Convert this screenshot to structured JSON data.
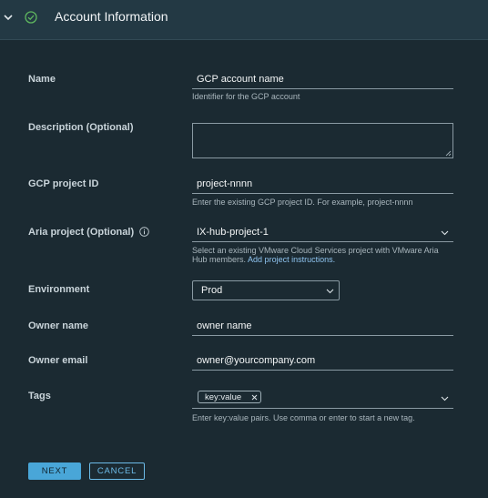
{
  "header": {
    "title": "Account Information",
    "status_color": "#5fb85f"
  },
  "form": {
    "name": {
      "label": "Name",
      "value": "GCP account name",
      "help": "Identifier for the GCP account"
    },
    "description": {
      "label": "Description (Optional)",
      "value": ""
    },
    "gcp_project_id": {
      "label": "GCP project ID",
      "value": "project-nnnn",
      "help": "Enter the existing GCP project ID. For example, project-nnnn"
    },
    "aria_project": {
      "label": "Aria project (Optional)",
      "value": "IX-hub-project-1",
      "help_line1": "Select an existing VMware Cloud Services project with VMware Aria",
      "help_line2": "Hub members.",
      "help_link": "Add project instructions."
    },
    "environment": {
      "label": "Environment",
      "value": "Prod"
    },
    "owner_name": {
      "label": "Owner name",
      "value": "owner name"
    },
    "owner_email": {
      "label": "Owner email",
      "value": "owner@yourcompany.com"
    },
    "tags": {
      "label": "Tags",
      "tag": "key:value",
      "help": "Enter key:value pairs. Use comma or enter to start a new tag."
    }
  },
  "buttons": {
    "next": "NEXT",
    "cancel": "CANCEL"
  },
  "colors": {
    "background": "#1b2a32",
    "header": "#233944",
    "accent": "#49a6d8",
    "link": "#8fc4f0"
  }
}
